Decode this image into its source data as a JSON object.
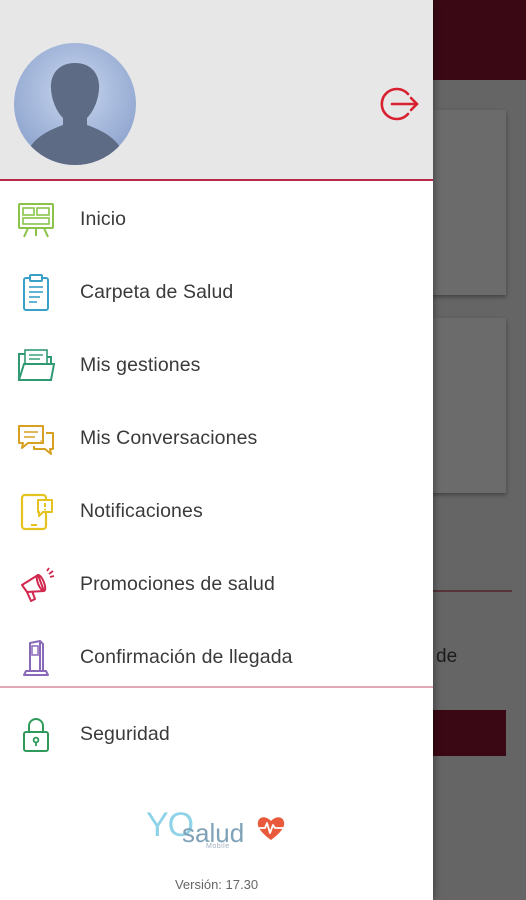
{
  "background": {
    "partial_text": "de"
  },
  "drawer": {
    "logout_icon": "logout-icon",
    "menu": [
      {
        "id": "inicio",
        "label": "Inicio",
        "icon": "dashboard-board-icon",
        "color": "#8bc34a"
      },
      {
        "id": "carpeta",
        "label": "Carpeta de Salud",
        "icon": "clipboard-icon",
        "color": "#3aa0c8"
      },
      {
        "id": "gestiones",
        "label": "Mis gestiones",
        "icon": "folder-icon",
        "color": "#2f9a72"
      },
      {
        "id": "conversaciones",
        "label": "Mis Conversaciones",
        "icon": "chat-bubbles-icon",
        "color": "#d7a021"
      },
      {
        "id": "notificaciones",
        "label": "Notificaciones",
        "icon": "phone-alert-icon",
        "color": "#e6c21e"
      },
      {
        "id": "promociones",
        "label": "Promociones de salud",
        "icon": "megaphone-icon",
        "color": "#d2284e"
      },
      {
        "id": "confirmacion",
        "label": "Confirmación de llegada",
        "icon": "kiosk-icon",
        "color": "#8a6ab8"
      }
    ],
    "security": {
      "label": "Seguridad",
      "icon": "lock-icon",
      "color": "#2f9a5a"
    },
    "brand": {
      "yo": "YO",
      "salud": "salud",
      "sub": "Mobile"
    },
    "version": "Versión: 17.30"
  },
  "colors": {
    "app_bar": "#8a1431",
    "header_divider": "#b5294a",
    "logout": "#d9202f"
  }
}
